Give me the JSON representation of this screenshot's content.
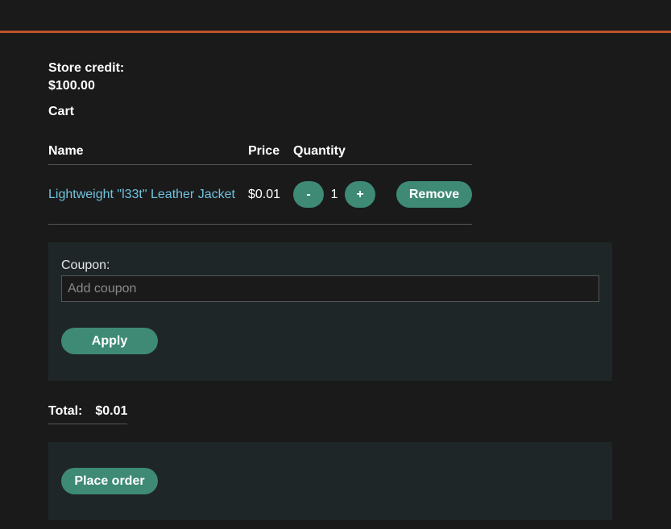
{
  "store_credit": {
    "label": "Store credit:",
    "value": "$100.00"
  },
  "cart": {
    "title": "Cart",
    "columns": [
      "Name",
      "Price",
      "Quantity"
    ],
    "items": [
      {
        "name": "Lightweight \"l33t\" Leather Jacket",
        "price": "$0.01",
        "quantity": "1",
        "decrement_label": "-",
        "increment_label": "+",
        "remove_label": "Remove"
      }
    ]
  },
  "coupon": {
    "label": "Coupon:",
    "placeholder": "Add coupon",
    "value": "",
    "apply_label": "Apply"
  },
  "total": {
    "label": "Total:",
    "value": "$0.01"
  },
  "order": {
    "place_order_label": "Place order"
  },
  "colors": {
    "accent_bar": "#c0532a",
    "button": "#3e8a75",
    "link": "#6fc3df",
    "panel": "#1f2628",
    "background": "#1a1a1a"
  }
}
